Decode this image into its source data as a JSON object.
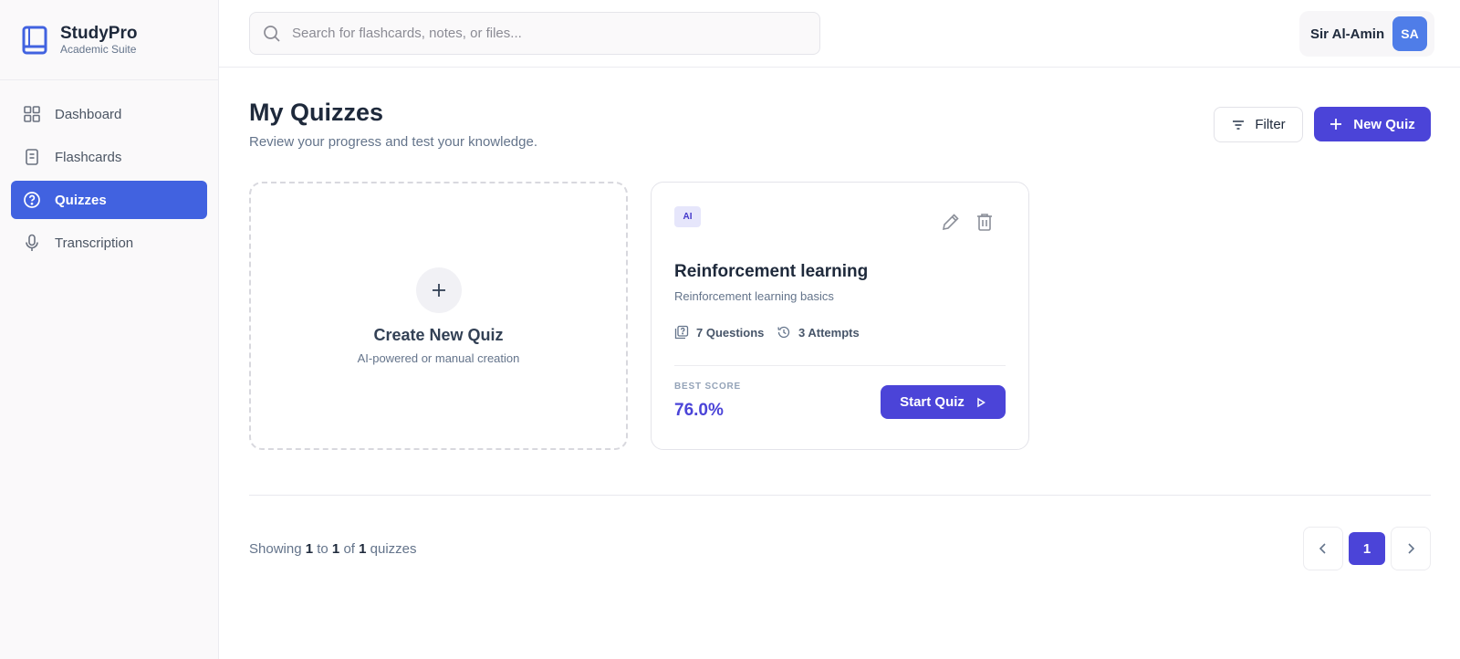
{
  "brand": {
    "name": "StudyPro",
    "subtitle": "Academic Suite"
  },
  "sidebar": {
    "items": [
      {
        "label": "Dashboard",
        "icon": "grid-icon",
        "active": false
      },
      {
        "label": "Flashcards",
        "icon": "document-icon",
        "active": false
      },
      {
        "label": "Quizzes",
        "icon": "question-circle-icon",
        "active": true
      },
      {
        "label": "Transcription",
        "icon": "microphone-icon",
        "active": false
      }
    ]
  },
  "search": {
    "placeholder": "Search for flashcards, notes, or files...",
    "value": ""
  },
  "user": {
    "name": "Sir Al-Amin",
    "initials": "SA"
  },
  "page": {
    "title": "My Quizzes",
    "subtitle": "Review your progress and test your knowledge.",
    "filter_label": "Filter",
    "new_quiz_label": "New Quiz"
  },
  "create_card": {
    "title": "Create New Quiz",
    "subtitle": "AI-powered or manual creation"
  },
  "quizzes": [
    {
      "badge": "AI",
      "title": "Reinforcement learning",
      "description": "Reinforcement learning basics",
      "questions": "7 Questions",
      "attempts": "3 Attempts",
      "best_score_label": "BEST SCORE",
      "best_score": "76.0%",
      "start_label": "Start Quiz"
    }
  ],
  "pagination": {
    "prefix": "Showing",
    "from": "1",
    "to_word": "to",
    "to": "1",
    "of_word": "of",
    "total": "1",
    "suffix": "quizzes",
    "current_page": "1"
  },
  "colors": {
    "accent": "#4b44d8",
    "sidebar_active": "#4162e0",
    "avatar": "#4f7de8"
  }
}
